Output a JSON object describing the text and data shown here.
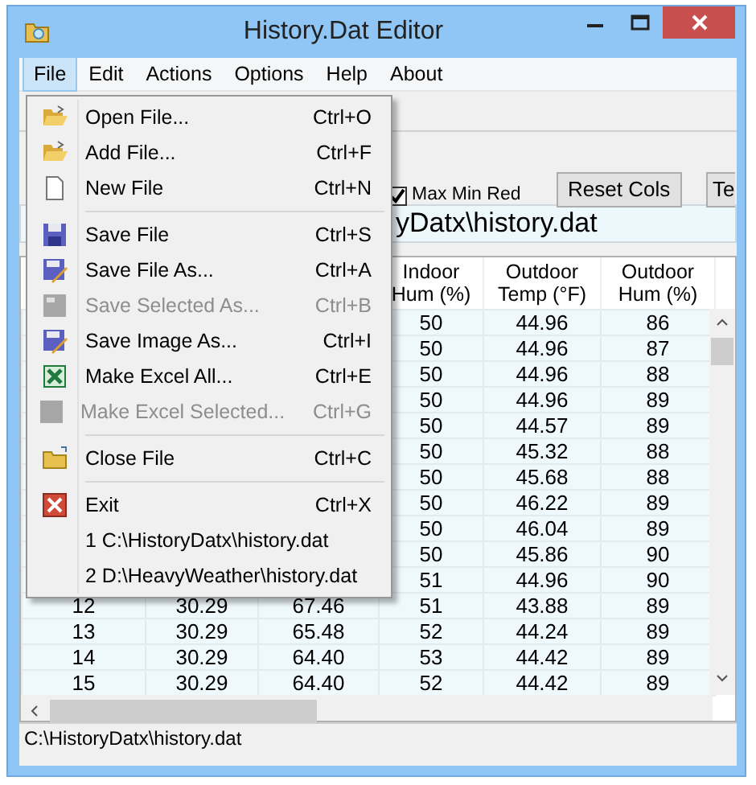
{
  "window": {
    "title": "History.Dat Editor"
  },
  "menu_bar": [
    {
      "label": "File",
      "selected": true
    },
    {
      "label": "Edit",
      "selected": false
    },
    {
      "label": "Actions",
      "selected": false
    },
    {
      "label": "Options",
      "selected": false
    },
    {
      "label": "Help",
      "selected": false
    },
    {
      "label": "About",
      "selected": false
    }
  ],
  "file_menu": {
    "items": [
      {
        "kind": "item",
        "label": "Open File...",
        "shortcut": "Ctrl+O",
        "disabled": false
      },
      {
        "kind": "item",
        "label": "Add File...",
        "shortcut": "Ctrl+F",
        "disabled": false
      },
      {
        "kind": "item",
        "label": "New File",
        "shortcut": "Ctrl+N",
        "disabled": false
      },
      {
        "kind": "separator"
      },
      {
        "kind": "item",
        "label": "Save File",
        "shortcut": "Ctrl+S",
        "disabled": false
      },
      {
        "kind": "item",
        "label": "Save File As...",
        "shortcut": "Ctrl+A",
        "disabled": false
      },
      {
        "kind": "item",
        "label": "Save Selected As...",
        "shortcut": "Ctrl+B",
        "disabled": true
      },
      {
        "kind": "item",
        "label": "Save Image As...",
        "shortcut": "Ctrl+I",
        "disabled": false
      },
      {
        "kind": "item",
        "label": "Make Excel All...",
        "shortcut": "Ctrl+E",
        "disabled": false
      },
      {
        "kind": "item",
        "label": "Make Excel Selected...",
        "shortcut": "Ctrl+G",
        "disabled": true
      },
      {
        "kind": "separator"
      },
      {
        "kind": "item",
        "label": "Close File",
        "shortcut": "Ctrl+C",
        "disabled": false
      },
      {
        "kind": "separator"
      },
      {
        "kind": "item",
        "label": "Exit",
        "shortcut": "Ctrl+X",
        "disabled": false
      },
      {
        "kind": "recent",
        "label": "1 C:\\HistoryDatx\\history.dat"
      },
      {
        "kind": "recent",
        "label": "2 D:\\HeavyWeather\\history.dat"
      }
    ]
  },
  "toolbar": {
    "checkbox": {
      "label": "Max Min Red",
      "checked": true
    },
    "buttons": [
      "Reset Cols",
      "Te"
    ]
  },
  "path_field": {
    "value": "yDatx\\history.dat"
  },
  "table": {
    "columns": [
      "Indoor Hum (%)",
      "Outdoor Temp (°F)",
      "Outdoor Hum (%)"
    ],
    "rows": [
      {
        "cells": [
          "50",
          "44.96",
          "86"
        ]
      },
      {
        "cells": [
          "50",
          "44.96",
          "87"
        ]
      },
      {
        "cells": [
          "50",
          "44.96",
          "88"
        ]
      },
      {
        "cells": [
          "50",
          "44.96",
          "89"
        ]
      },
      {
        "cells": [
          "50",
          "44.57",
          "89"
        ]
      },
      {
        "cells": [
          "50",
          "45.32",
          "88"
        ]
      },
      {
        "cells": [
          "50",
          "45.68",
          "88"
        ]
      },
      {
        "cells": [
          "50",
          "46.22",
          "89"
        ]
      },
      {
        "cells": [
          "50",
          "46.04",
          "89"
        ]
      },
      {
        "cells": [
          "50",
          "45.86",
          "90"
        ]
      },
      {
        "cells": [
          "51",
          "44.96",
          "90"
        ]
      },
      {
        "lead_cells": [
          "12",
          "30.29",
          "67.46"
        ],
        "cells": [
          "51",
          "43.88",
          "89"
        ]
      },
      {
        "lead_cells": [
          "13",
          "30.29",
          "65.48"
        ],
        "cells": [
          "52",
          "44.24",
          "89"
        ]
      },
      {
        "lead_cells": [
          "14",
          "30.29",
          "64.40"
        ],
        "cells": [
          "53",
          "44.42",
          "89"
        ]
      },
      {
        "lead_cells": [
          "15",
          "30.29",
          "64.40"
        ],
        "cells": [
          "52",
          "44.42",
          "89"
        ]
      }
    ]
  },
  "status_bar": "C:\\HistoryDatx\\history.dat"
}
